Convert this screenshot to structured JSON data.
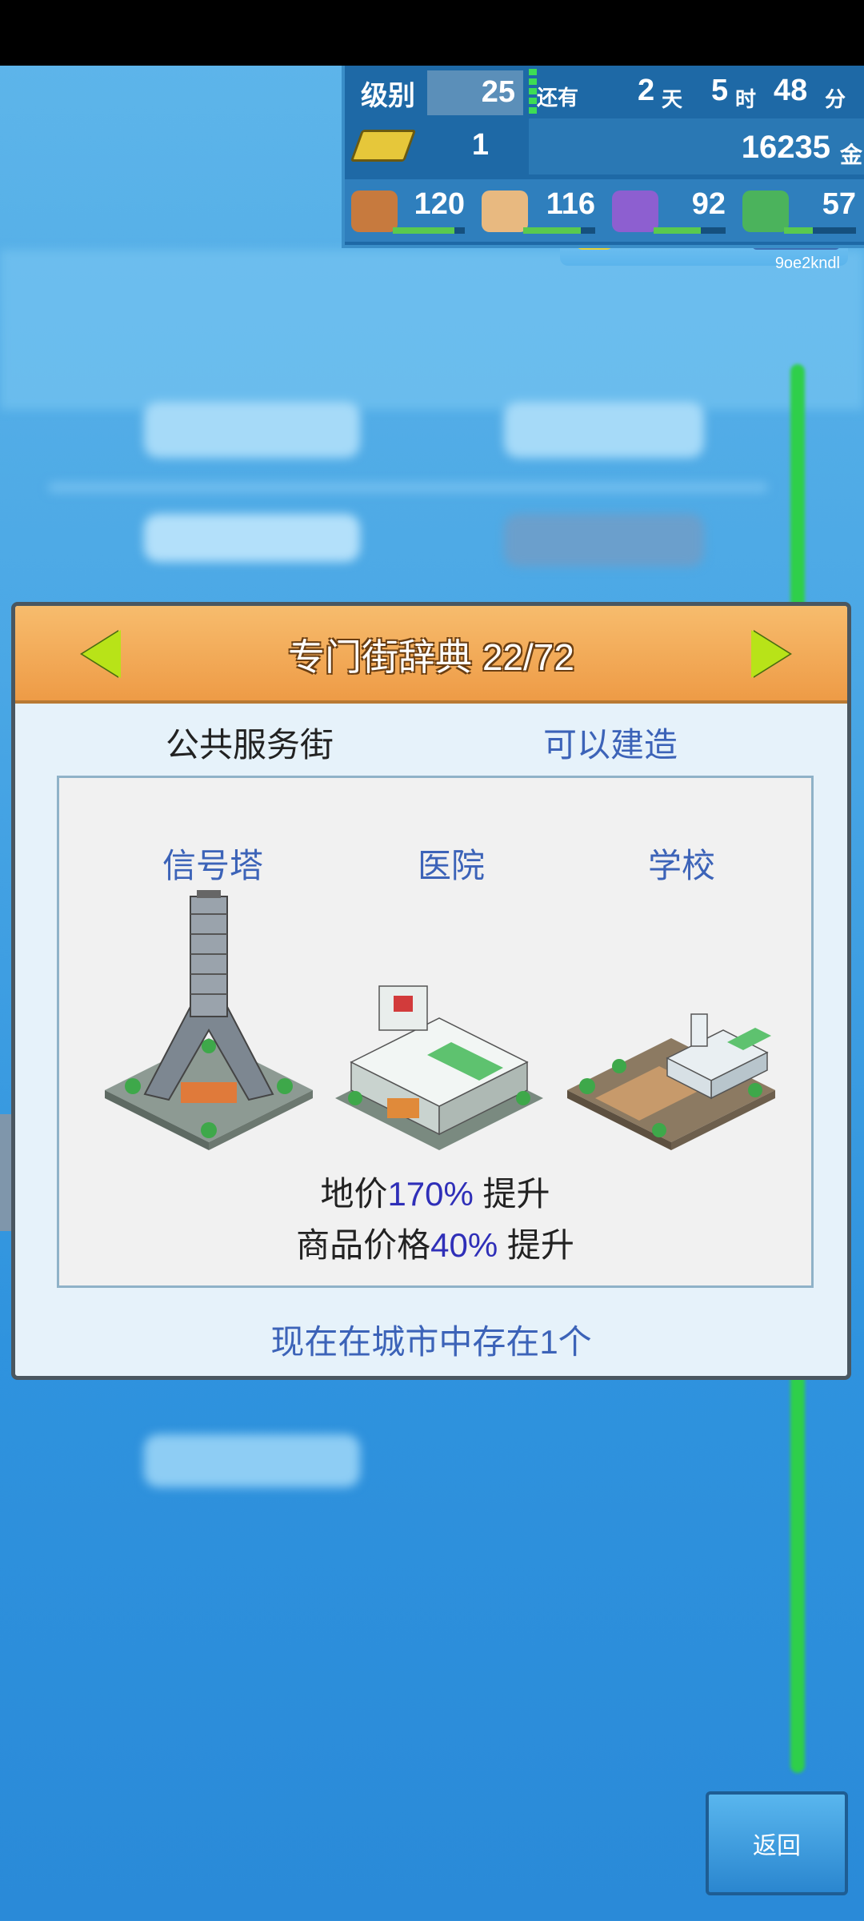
{
  "hud": {
    "level_label": "级别",
    "level": "25",
    "remaining_label": "还有",
    "days": "2",
    "days_unit": "天",
    "hours": "5",
    "hours_unit": "时",
    "minutes": "48",
    "minutes_unit": "分",
    "gold_bars": "1",
    "money": "16235",
    "money_unit": "金",
    "stats": [
      {
        "icon": "food-icon",
        "value": "120",
        "bar_fill": 0.85
      },
      {
        "icon": "shopping-bag-icon",
        "value": "116",
        "bar_fill": 0.8
      },
      {
        "icon": "music-note-icon",
        "value": "92",
        "bar_fill": 0.65
      },
      {
        "icon": "book-icon",
        "value": "57",
        "bar_fill": 0.4
      }
    ]
  },
  "user_id": "9oe2kndl",
  "dialog": {
    "title": "专门街辞典 22/72",
    "category": "公共服务街",
    "status": "可以建造",
    "buildings": [
      {
        "name": "信号塔",
        "icon": "signal-tower-icon"
      },
      {
        "name": "医院",
        "icon": "hospital-icon"
      },
      {
        "name": "学校",
        "icon": "school-icon"
      }
    ],
    "effect1": {
      "prefix": "地价",
      "value": "170%",
      "suffix": " 提升"
    },
    "effect2": {
      "prefix": "商品价格",
      "value": "40%",
      "suffix": " 提升"
    },
    "exists_text": "现在在城市中存在1个"
  },
  "side_tab_glyph": "›",
  "back_label": "返回",
  "colors": {
    "accent_orange": "#ee9b46",
    "arrow_green": "#b8e318",
    "link_blue": "#3c63b8",
    "highlight_blue": "#2f2fb8"
  }
}
